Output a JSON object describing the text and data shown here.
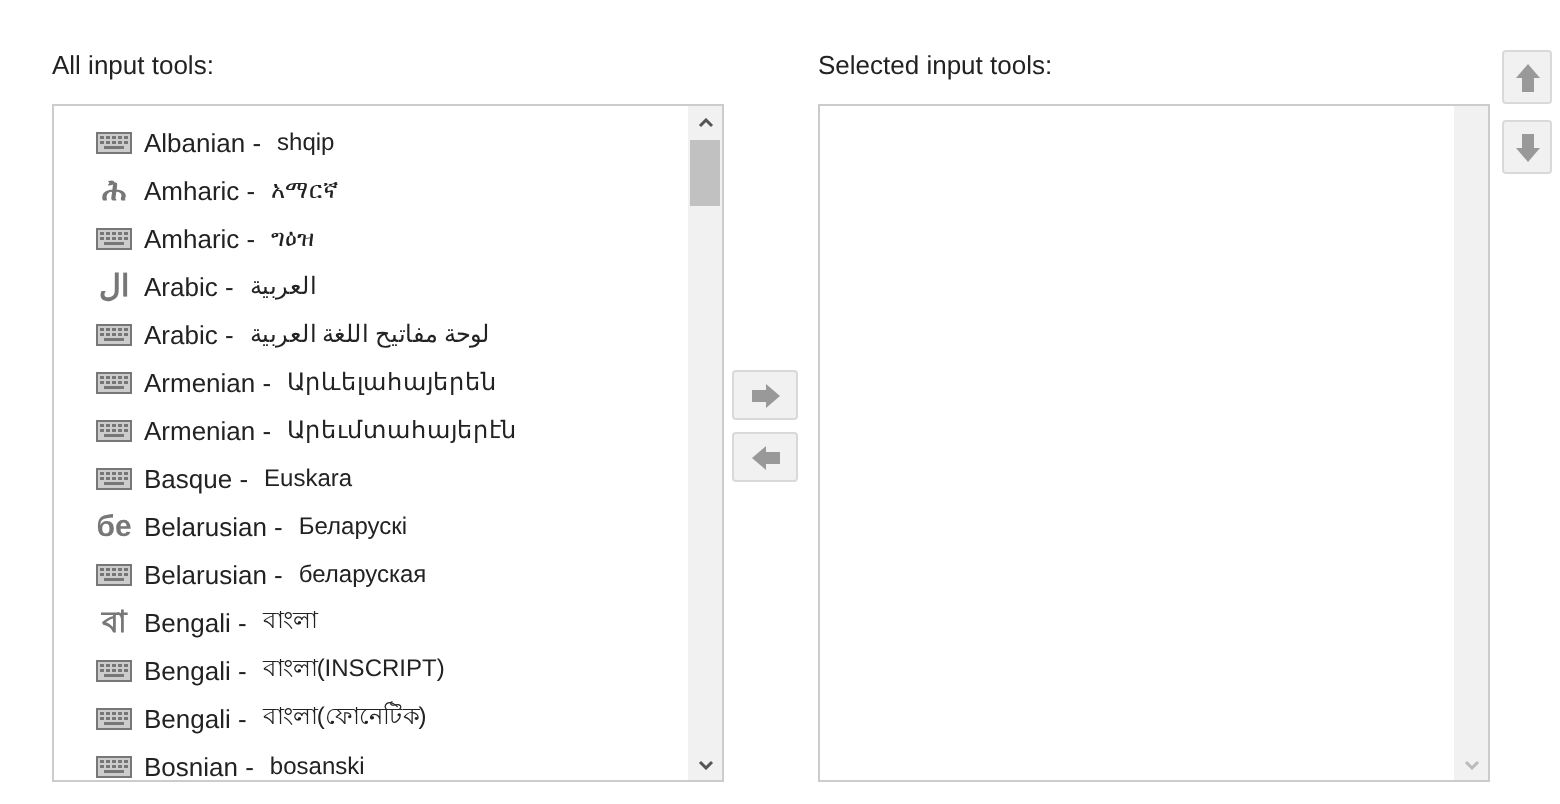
{
  "all_tools": {
    "heading": "All input tools:",
    "items": [
      {
        "kind": "keyboard",
        "label": "Albanian -",
        "native": "shqip"
      },
      {
        "kind": "glyph",
        "glyph": "ሕ",
        "label": "Amharic -",
        "native": "አማርኛ"
      },
      {
        "kind": "keyboard",
        "label": "Amharic -",
        "native": "ግዕዝ"
      },
      {
        "kind": "glyph",
        "glyph": "ال",
        "label": "Arabic -",
        "native": "العربية"
      },
      {
        "kind": "keyboard",
        "label": "Arabic -",
        "native": "لوحة مفاتيح اللغة العربية"
      },
      {
        "kind": "keyboard",
        "label": "Armenian -",
        "native": "Արևելահայերեն"
      },
      {
        "kind": "keyboard",
        "label": "Armenian -",
        "native": "Արեւմտահայերէն"
      },
      {
        "kind": "keyboard",
        "label": "Basque -",
        "native": "Euskara"
      },
      {
        "kind": "glyph",
        "glyph": "бе",
        "label": "Belarusian -",
        "native": "Беларускі"
      },
      {
        "kind": "keyboard",
        "label": "Belarusian -",
        "native": "беларуская"
      },
      {
        "kind": "glyph",
        "glyph": "বা",
        "label": "Bengali -",
        "native": "বাংলা"
      },
      {
        "kind": "keyboard",
        "label": "Bengali -",
        "native": "বাংলা(INSCRIPT)"
      },
      {
        "kind": "keyboard",
        "label": "Bengali -",
        "native": "বাংলা(ফোনেটিক)"
      },
      {
        "kind": "keyboard",
        "label": "Bosnian -",
        "native": "bosanski"
      }
    ]
  },
  "selected_tools": {
    "heading": "Selected input tools:"
  }
}
